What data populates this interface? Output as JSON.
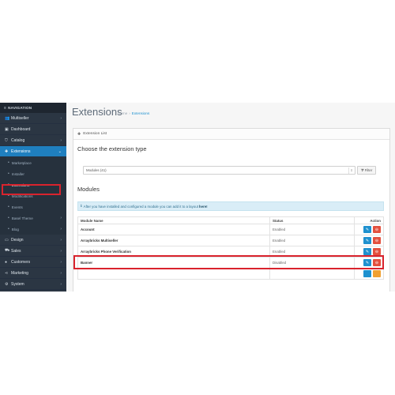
{
  "sidebar": {
    "header": "NAVIGATION",
    "items": [
      {
        "label": "Multiseller",
        "icon": "users-icon",
        "glyph": "👥"
      },
      {
        "label": "Dashboard",
        "icon": "dashboard-icon",
        "glyph": "▣"
      },
      {
        "label": "Catalog",
        "icon": "tag-icon",
        "glyph": "⛉"
      },
      {
        "label": "Extensions",
        "icon": "puzzle-icon",
        "glyph": "✚"
      }
    ],
    "subitems": [
      {
        "label": "Marketplace"
      },
      {
        "label": "Installer"
      },
      {
        "label": "Extensions"
      },
      {
        "label": "Modifications"
      },
      {
        "label": "Events"
      },
      {
        "label": "Basel Theme"
      },
      {
        "label": "Blog"
      }
    ],
    "items_after": [
      {
        "label": "Design",
        "icon": "monitor-icon",
        "glyph": "▭"
      },
      {
        "label": "Sales",
        "icon": "cart-icon",
        "glyph": "⛟"
      },
      {
        "label": "Customers",
        "icon": "user-icon",
        "glyph": "●"
      },
      {
        "label": "Marketing",
        "icon": "share-icon",
        "glyph": "⋖"
      },
      {
        "label": "System",
        "icon": "gear-icon",
        "glyph": "⚙"
      }
    ]
  },
  "main": {
    "title": "Extensions",
    "breadcrumb": {
      "home": "Home",
      "separator": "›",
      "current": "Extensions"
    },
    "panel_title": "Extension List",
    "choose_title": "Choose the extension type",
    "select_value": "Modules (41)",
    "filter_label": "Filter",
    "modules_title": "Modules",
    "alert_text": "After you have installed and configured a module you can add it to a layout",
    "alert_link": "here!",
    "table": {
      "headers": {
        "name": "Module Name",
        "status": "Status",
        "action": "Action"
      },
      "rows": [
        {
          "name": "Account",
          "status": "Enabled"
        },
        {
          "name": "Arraybricks Multiseller",
          "status": "Enabled"
        },
        {
          "name": "Arraybricks Phone Verification",
          "status": "Enabled"
        },
        {
          "name": "Banner",
          "status": "Disabled"
        },
        {
          "name": "",
          "status": ""
        }
      ]
    }
  },
  "colors": {
    "accent": "#1e91cf",
    "danger": "#e3503e",
    "sidebar": "#2b3643",
    "highlight": "#d9232d"
  }
}
